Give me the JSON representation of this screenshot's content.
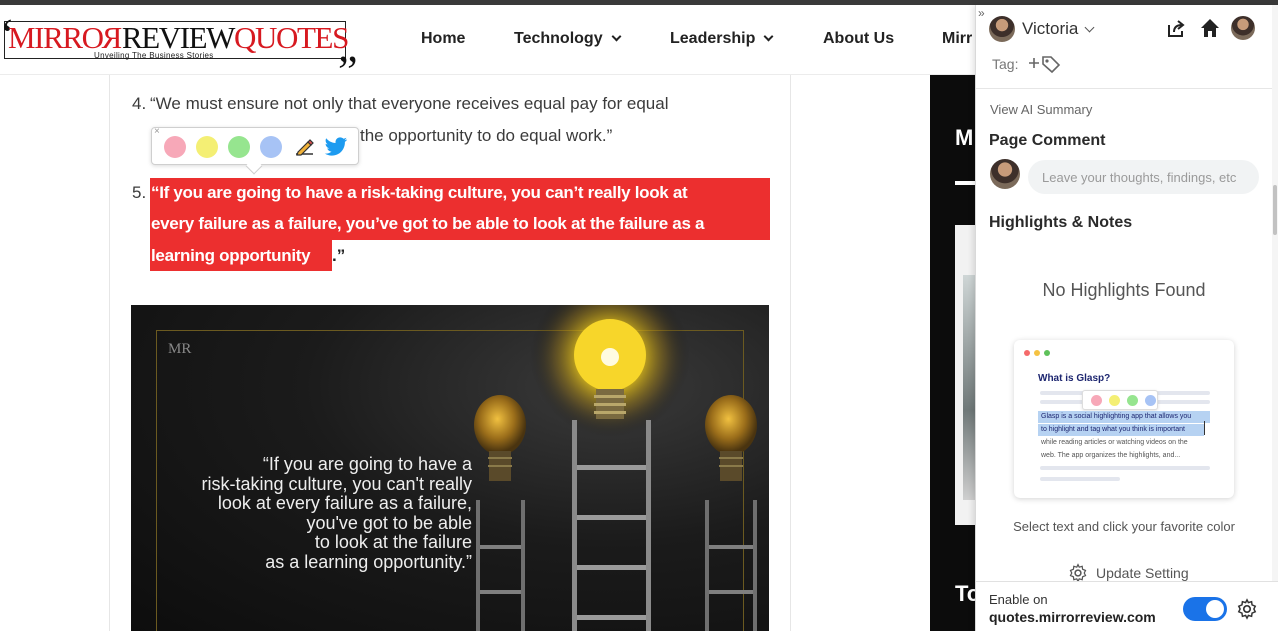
{
  "site": {
    "logo": {
      "text_mirror": "MIRRO",
      "text_reversed_r": "R",
      "text_review": "REVIEW",
      "text_quotes": "QUOTES",
      "tagline": "Unveiling The Business Stories"
    },
    "nav": [
      {
        "label": "Home",
        "has_dropdown": false
      },
      {
        "label": "Technology",
        "has_dropdown": true
      },
      {
        "label": "Leadership",
        "has_dropdown": true
      },
      {
        "label": "About Us",
        "has_dropdown": false
      },
      {
        "label": "Mirr",
        "has_dropdown": false
      }
    ],
    "sidebar_heading_partial": "M",
    "sidebar_bottom_partial": "To"
  },
  "article": {
    "quote4": {
      "number": "4.",
      "line1": "“We must ensure not only that everyone receives equal pay for equal",
      "line2": "the opportunity to do equal work.”"
    },
    "quote5": {
      "number": "5.",
      "line1": "“If you are going to have a risk-taking culture, you can’t really look at",
      "line2": "every failure as a failure, you’ve got to be able to look at the failure as a",
      "line3": "learning opportunity",
      "line3_tail": ".”",
      "highlight_color": "#ec2f2f"
    },
    "image": {
      "watermark": "MR",
      "quote": "“If you are going to have a\nrisk-taking culture, you can't really\nlook at every failure as a failure,\nyou've got to be able\nto look at the failure\nas a learning opportunity.”"
    }
  },
  "color_popup": {
    "close_glyph": "×",
    "colors": [
      "#f7a8b8",
      "#f4ef74",
      "#96e58f",
      "#a7c3f5"
    ],
    "icons": [
      "pen-icon",
      "twitter-icon"
    ]
  },
  "glasp": {
    "collapse_glyph": "»",
    "user_name": "Victoria",
    "tag_label": "Tag:",
    "ai_summary_link": "View AI Summary",
    "page_comment_heading": "Page Comment",
    "comment_placeholder": "Leave your thoughts, findings, etc",
    "highlights_heading": "Highlights & Notes",
    "empty_state": "No Highlights Found",
    "demo": {
      "title": "What is Glasp?",
      "sel_line1": "Glasp is a social highlighting app that allows you",
      "sel_line2": "to highlight and tag what you think is important",
      "line3": "while reading articles or watching videos on the",
      "line4": "web. The app organizes the highlights, and..."
    },
    "hint": "Select text and click your favorite color",
    "update_setting": "Update Setting",
    "enable_label": "Enable on",
    "domain": "quotes.mirrorreview.com",
    "enabled": true,
    "accent_color": "#1a73e8"
  }
}
